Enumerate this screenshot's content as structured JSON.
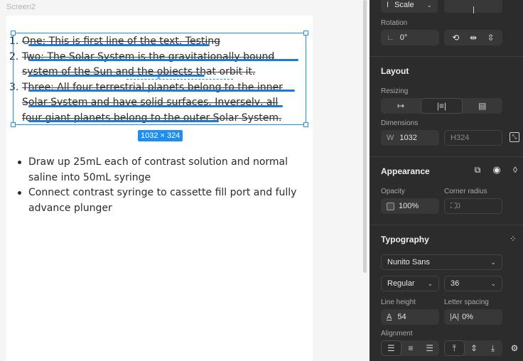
{
  "canvas": {
    "frame_label": "Screen2",
    "ordered_list": [
      {
        "num": "1.",
        "text": "One: This is first line of the text. Testing"
      },
      {
        "num": "2.",
        "text": "Two: The Solar System is the gravitationally bound system of the Sun and the objects that orbit it."
      },
      {
        "num": "3.",
        "text": "Three: All four terrestrial planets belong to the inner Solar System and have solid surfaces. Inversely, all four giant planets belong to the outer Solar System."
      }
    ],
    "selection_dims": "1032 × 324",
    "bullets": [
      "Draw up 25mL each of contrast solution and normal saline into 50mL syringe",
      "Connect contrast syringe to cassette fill port and fully advance plunger"
    ]
  },
  "panel": {
    "scale_label": "Scale",
    "rotation": {
      "label": "Rotation",
      "value": "0°"
    },
    "layout": {
      "title": "Layout",
      "resizing_label": "Resizing",
      "dimensions_label": "Dimensions",
      "w_label": "W",
      "w_value": "1032",
      "h_label": "H",
      "h_value": "324"
    },
    "appearance": {
      "title": "Appearance",
      "opacity_label": "Opacity",
      "opacity_value": "100%",
      "corner_radius_label": "Corner radius",
      "corner_radius_value": "0"
    },
    "typography": {
      "title": "Typography",
      "font_family": "Nunito Sans",
      "font_weight": "Regular",
      "font_size": "36",
      "line_height_label": "Line height",
      "line_height_value": "54",
      "letter_spacing_label": "Letter spacing",
      "letter_spacing_value": "0%",
      "alignment_label": "Alignment"
    }
  },
  "colors": {
    "selection": "#1d8ff0",
    "panel_bg": "#2c2c2c",
    "underline": "#1d7ad6"
  }
}
